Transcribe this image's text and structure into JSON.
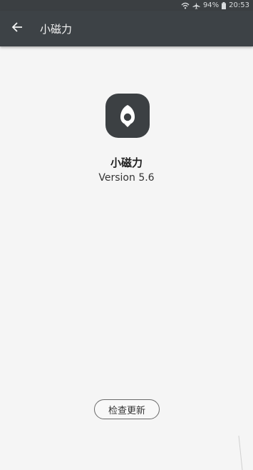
{
  "status_bar": {
    "icons": [
      "wifi-icon",
      "airplane-icon",
      "battery-icon"
    ],
    "battery": "94%",
    "time": "20:53"
  },
  "app_bar": {
    "back_icon": "arrow-left-icon",
    "title": "小磁力"
  },
  "about": {
    "app_icon": "magnet-pin-icon",
    "app_name": "小磁力",
    "version": "Version 5.6",
    "check_update_label": "检查更新"
  },
  "colors": {
    "toolbar": "#3d4246",
    "background": "#f5f5f5",
    "icon_bg": "#3c4043"
  }
}
